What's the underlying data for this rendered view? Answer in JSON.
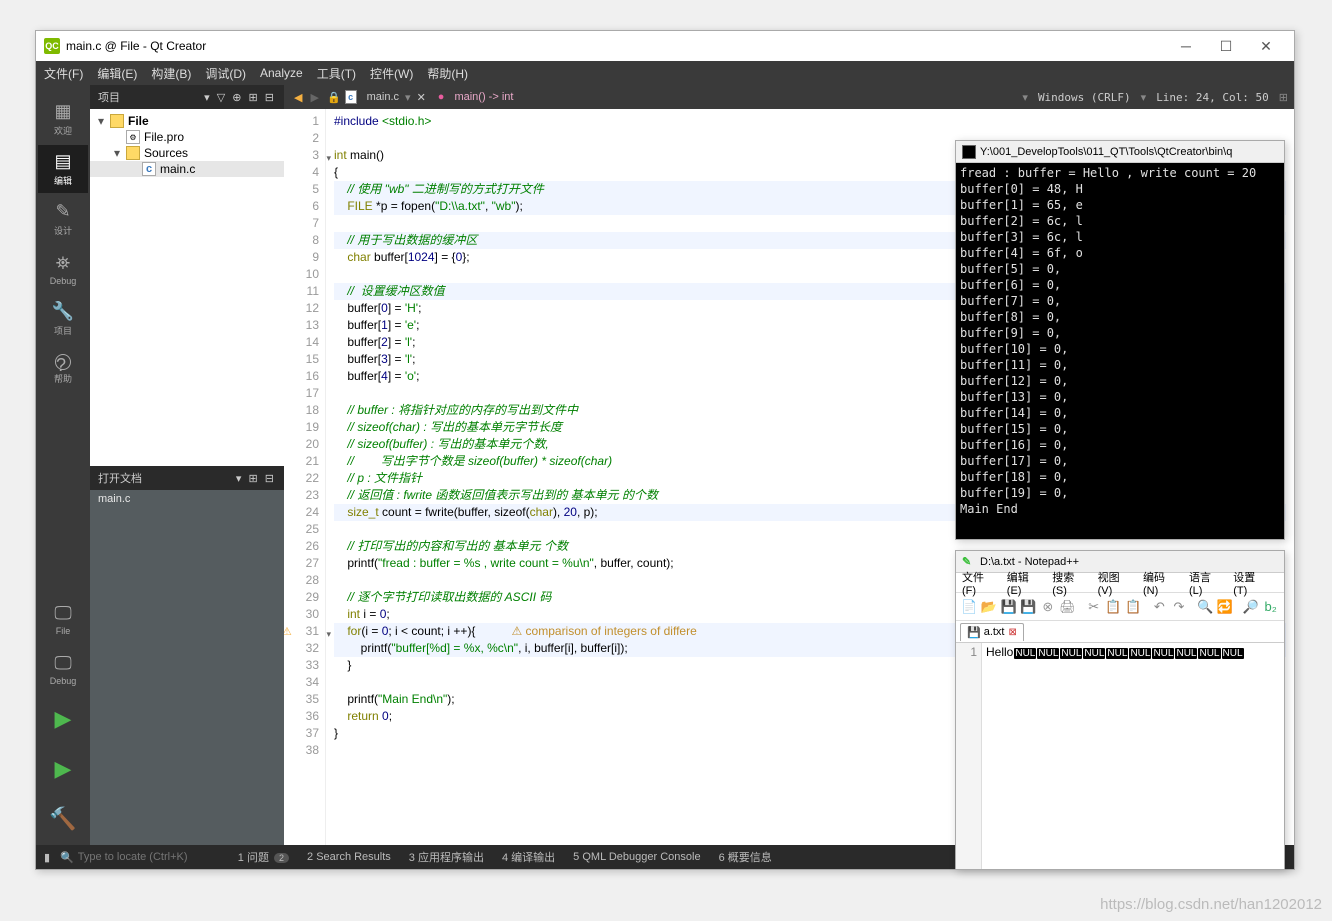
{
  "qtcreator": {
    "title": "main.c @ File - Qt Creator",
    "menus": [
      "文件(F)",
      "编辑(E)",
      "构建(B)",
      "调试(D)",
      "Analyze",
      "工具(T)",
      "控件(W)",
      "帮助(H)"
    ],
    "leftTools": [
      {
        "icon": "▦",
        "label": "欢迎"
      },
      {
        "icon": "▤",
        "label": "编辑"
      },
      {
        "icon": "✎",
        "label": "设计"
      },
      {
        "icon": "⛯",
        "label": "Debug"
      },
      {
        "icon": "🔧",
        "label": "项目"
      },
      {
        "icon": "?",
        "label": "帮助"
      }
    ],
    "bottomTools": [
      {
        "label": "File"
      },
      {
        "label": "▭"
      },
      {
        "label": "Debug"
      }
    ],
    "projectHeader": "项目",
    "tree": {
      "root": "File",
      "pro": "File.pro",
      "sources": "Sources",
      "mainc": "main.c"
    },
    "docsHeader": "打开文档",
    "openDoc": "main.c",
    "editorTab": "main.c",
    "funcSig": "main() -> int",
    "encoding": "Windows (CRLF)",
    "cursor": "Line: 24, Col: 50",
    "warning": "comparison of integers of differe",
    "code": {
      "l1": "#include <stdio.h>",
      "l3": "int main()",
      "l4": "{",
      "l5": "    // 使用 \"wb\" 二进制写的方式打开文件",
      "l6": "    FILE *p = fopen(\"D:\\\\a.txt\", \"wb\");",
      "l8": "    // 用于写出数据的缓冲区",
      "l9": "    char buffer[1024] = {0};",
      "l11": "    //  设置缓冲区数值",
      "l12": "    buffer[0] = 'H';",
      "l13": "    buffer[1] = 'e';",
      "l14": "    buffer[2] = 'l';",
      "l15": "    buffer[3] = 'l';",
      "l16": "    buffer[4] = 'o';",
      "l18": "    // buffer : 将指针对应的内存的写出到文件中",
      "l19": "    // sizeof(char) : 写出的基本单元字节长度",
      "l20": "    // sizeof(buffer) : 写出的基本单元个数,",
      "l21": "    //        写出字节个数是 sizeof(buffer) * sizeof(char)",
      "l22": "    // p : 文件指针",
      "l23": "    // 返回值 : fwrite 函数返回值表示写出到的 基本单元 的个数",
      "l24": "    size_t count = fwrite(buffer, sizeof(char), 20, p);",
      "l26": "    // 打印写出的内容和写出的 基本单元 个数",
      "l27": "    printf(\"fread : buffer = %s , write count = %u\\n\", buffer, count);",
      "l29": "    // 逐个字节打印读取出数据的 ASCII 码",
      "l30": "    int i = 0;",
      "l31": "    for(i = 0; i < count; i ++){",
      "l32": "        printf(\"buffer[%d] = %x, %c\\n\", i, buffer[i], buffer[i]);",
      "l33": "    }",
      "l35": "    printf(\"Main End\\n\");",
      "l36": "    return 0;",
      "l37": "}"
    },
    "statusbar": {
      "search": "Type to locate (Ctrl+K)",
      "items": [
        "1 问题",
        "2 Search Results",
        "3 应用程序输出",
        "4 编译输出",
        "5 QML Debugger Console",
        "6 概要信息"
      ],
      "badge": "2"
    }
  },
  "terminal": {
    "title": "Y:\\001_DevelopTools\\011_QT\\Tools\\QtCreator\\bin\\q",
    "lines": [
      "fread : buffer = Hello , write count = 20",
      "buffer[0] = 48, H",
      "buffer[1] = 65, e",
      "buffer[2] = 6c, l",
      "buffer[3] = 6c, l",
      "buffer[4] = 6f, o",
      "buffer[5] = 0,",
      "buffer[6] = 0,",
      "buffer[7] = 0,",
      "buffer[8] = 0,",
      "buffer[9] = 0,",
      "buffer[10] = 0,",
      "buffer[11] = 0,",
      "buffer[12] = 0,",
      "buffer[13] = 0,",
      "buffer[14] = 0,",
      "buffer[15] = 0,",
      "buffer[16] = 0,",
      "buffer[17] = 0,",
      "buffer[18] = 0,",
      "buffer[19] = 0,",
      "Main End"
    ]
  },
  "npp": {
    "title": "D:\\a.txt - Notepad++",
    "menus": [
      "文件(F)",
      "编辑(E)",
      "搜索(S)",
      "视图(V)",
      "编码(N)",
      "语言(L)",
      "设置(T)"
    ],
    "tab": "a.txt",
    "content": "Hello",
    "nulCount": 10
  },
  "watermark": "https://blog.csdn.net/han1202012"
}
